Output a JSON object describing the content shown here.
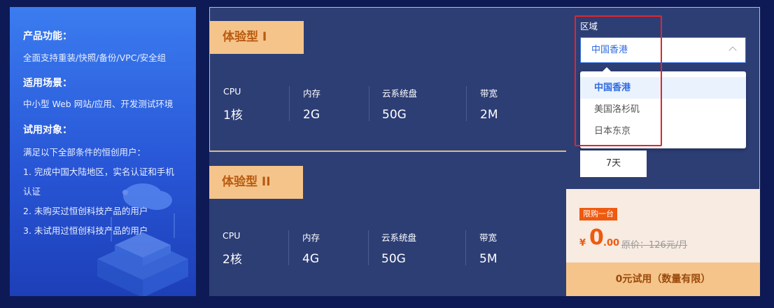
{
  "info": {
    "features_title": "产品功能：",
    "features_text": "全面支持重装/快照/备份/VPC/安全组",
    "scenarios_title": "适用场景：",
    "scenarios_text": "中小型 Web 网站/应用、开发测试环境",
    "audience_title": "试用对象：",
    "audience_lines": [
      "满足以下全部条件的恒创用户：",
      "1. 完成中国大陆地区，实名认证和手机",
      "认证",
      "2. 未购买过恒创科技产品的用户",
      "3. 未试用过恒创科技产品的用户"
    ]
  },
  "plans": [
    {
      "name": "体验型 I",
      "specs": [
        {
          "label": "CPU",
          "value": "1核"
        },
        {
          "label": "内存",
          "value": "2G"
        },
        {
          "label": "云系统盘",
          "value": "50G"
        },
        {
          "label": "带宽",
          "value": "2M"
        }
      ]
    },
    {
      "name": "体验型 II",
      "specs": [
        {
          "label": "CPU",
          "value": "2核"
        },
        {
          "label": "内存",
          "value": "4G"
        },
        {
          "label": "云系统盘",
          "value": "50G"
        },
        {
          "label": "带宽",
          "value": "5M"
        }
      ]
    }
  ],
  "region": {
    "label": "区域",
    "selected": "中国香港",
    "options": [
      "中国香港",
      "美国洛杉矶",
      "日本东京"
    ]
  },
  "duration": "7天",
  "price": {
    "limit_badge": "限购一台",
    "currency": "¥",
    "integer": "0",
    "decimal": ".00",
    "original": "原价：126元/月"
  },
  "cta_label": "0元试用（数量有限）",
  "colors": {
    "accent": "#ee5a0f",
    "badge_bg": "#f5c48a",
    "card_bg": "#2d3e75",
    "highlight": "#e0262b"
  }
}
